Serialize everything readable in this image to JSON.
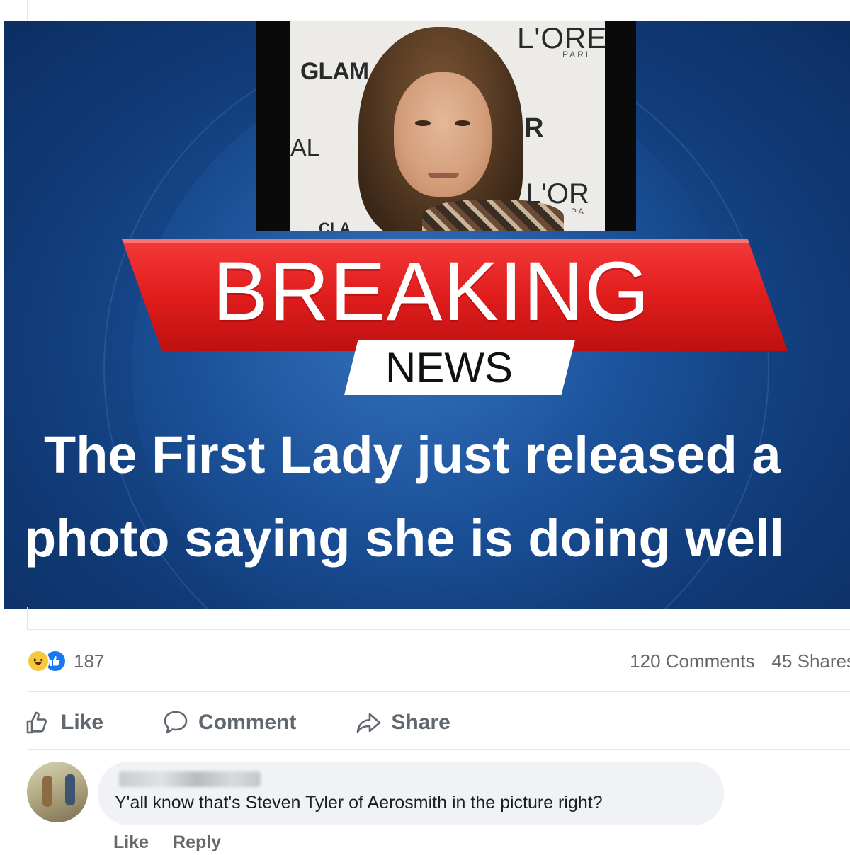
{
  "image": {
    "backdrop": {
      "glam": "GLAM",
      "lore_top": "L'ORE",
      "paris_top": "PARI",
      "r": "R",
      "al": "AL",
      "lore_bottom": "L'OR",
      "paris_bottom": "PA",
      "cla": "CLA"
    },
    "banner_title": "BREAKING",
    "banner_subtitle": "NEWS",
    "headline_line1": "The First Lady just released a",
    "headline_line2": "photo saying she is doing well"
  },
  "reactions": {
    "count": "187",
    "icons": [
      "haha-icon",
      "like-icon"
    ]
  },
  "stats": {
    "comments": "120 Comments",
    "shares": "45 Shares"
  },
  "actions": {
    "like": "Like",
    "comment": "Comment",
    "share": "Share"
  },
  "comment": {
    "text": "Y'all know that's Steven Tyler of Aerosmith in the picture right?",
    "like": "Like",
    "reply": "Reply"
  },
  "colors": {
    "banner_red": "#e11d1d",
    "background_blue": "#174a8f",
    "facebook_blue": "#1877f2",
    "muted_text": "#65676b"
  }
}
